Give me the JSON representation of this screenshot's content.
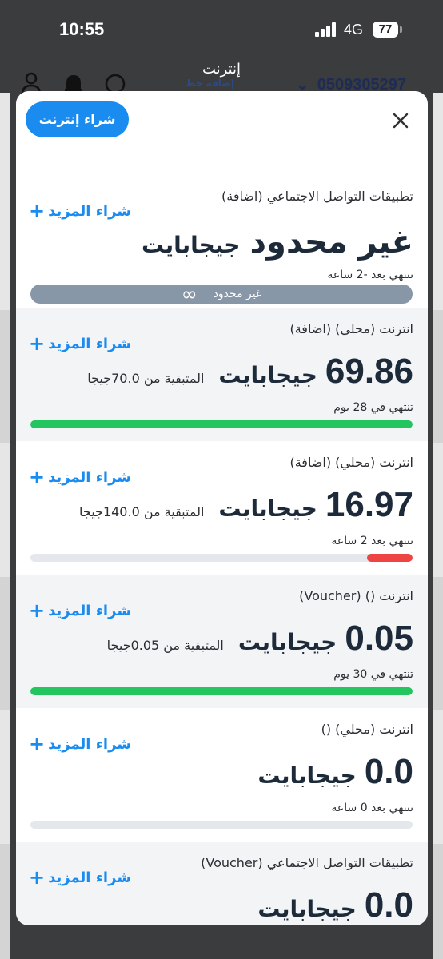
{
  "status_bar": {
    "time": "10:55",
    "network": "4G",
    "battery": "77"
  },
  "background_app": {
    "title": "إنترنت",
    "add_line": "إضافة خط",
    "phone": "0509305297"
  },
  "modal": {
    "buy_internet_label": "شراء إنترنت"
  },
  "unlimited_card": {
    "title": "تطبيقات التواصل الاجتماعي (اضافة)",
    "buy_more": "شراء المزيد",
    "big_text": "غير محدود",
    "unit": "جيجابايت",
    "expiry": "تنتهي بعد -2 ساعة",
    "bar_label": "غير محدود",
    "bar_icon": "∞"
  },
  "cards": [
    {
      "title": "انترنت (محلي) (اضافة)",
      "buy_more": "شراء المزيد",
      "amount": "69.86",
      "unit": "جيجابايت",
      "remaining": "المتبقية من 70.0جيجا",
      "expiry": "تنتهي في 28 يوم",
      "progress": 1.0,
      "color": "#22c55e",
      "from_left": true
    },
    {
      "title": "انترنت (محلي) (اضافة)",
      "buy_more": "شراء المزيد",
      "amount": "16.97",
      "unit": "جيجابايت",
      "remaining": "المتبقية من 140.0جيجا",
      "expiry": "تنتهي بعد 2 ساعة",
      "progress": 0.12,
      "color": "#ef4444",
      "from_left": false
    },
    {
      "title": "انترنت () (Voucher)",
      "buy_more": "شراء المزيد",
      "amount": "0.05",
      "unit": "جيجابايت",
      "remaining": "المتبقية من 0.05جيجا",
      "expiry": "تنتهي في 30 يوم",
      "progress": 1.0,
      "color": "#22c55e",
      "from_left": true
    },
    {
      "title": "انترنت (محلي) ()",
      "buy_more": "شراء المزيد",
      "amount": "0.0",
      "unit": "جيجابايت",
      "remaining": "",
      "expiry": "تنتهي بعد 0 ساعة",
      "progress": 0,
      "color": "#22c55e",
      "from_left": true
    },
    {
      "title": "تطبيقات التواصل الاجتماعي (Voucher)",
      "buy_more": "شراء المزيد",
      "amount": "0.0",
      "unit": "جيجابايت",
      "remaining": "",
      "expiry": "",
      "progress": 0,
      "color": "#22c55e",
      "from_left": true
    }
  ]
}
